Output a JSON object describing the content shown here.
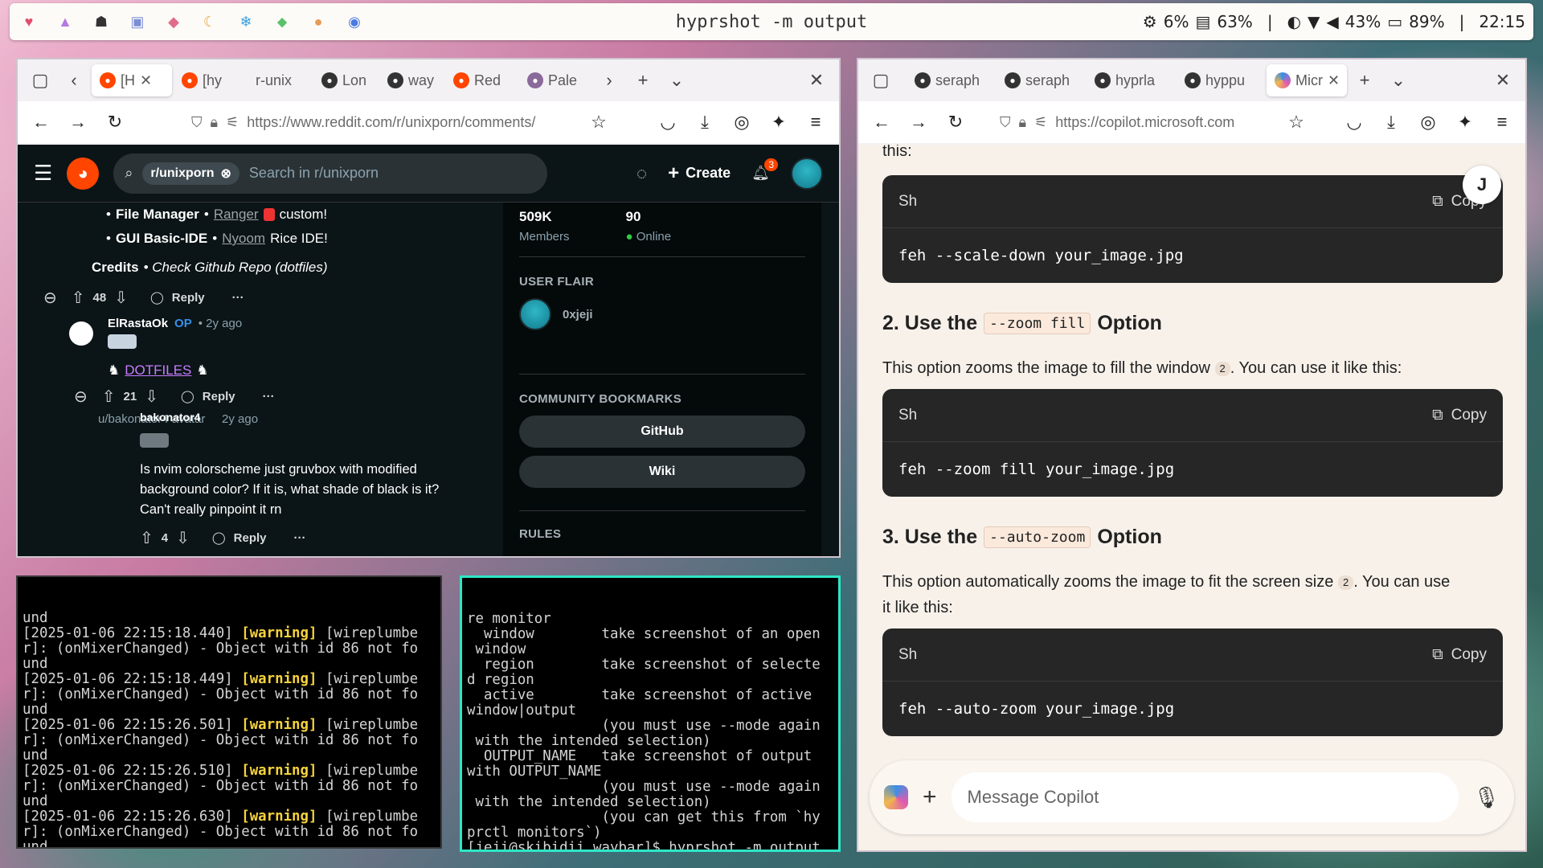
{
  "topbar": {
    "title": "hyprshot -m output",
    "cpu": "6%",
    "mem": "63%",
    "volume": "43%",
    "battery": "89%",
    "time": "22:15",
    "sep": "|"
  },
  "left_browser": {
    "tabs": [
      "[H",
      "[hy",
      "r-unix",
      "Lon",
      "way",
      "Red",
      "Pale"
    ],
    "url": "https://www.reddit.com/r/unixporn/comments/",
    "reddit": {
      "chip": "r/unixporn",
      "search_placeholder": "Search in r/unixporn",
      "create": "Create",
      "notif_count": "3",
      "post": {
        "fm_label": "File Manager",
        "fm_dot": "•",
        "fm_link": "Ranger",
        "fm_rest": "custom!",
        "ide_label": "GUI Basic-IDE",
        "ide_dot": "•",
        "ide_link": "Nyoom",
        "ide_rest": "Rice IDE!",
        "credits_label": "Credits",
        "credits_rest": "• Check Github Repo (dotfiles)",
        "votes": "48",
        "reply": "Reply",
        "more": "···"
      },
      "c1": {
        "user": "ElRastaOk",
        "op": "OP",
        "time": "• 2y ago",
        "link": "DOTFILES",
        "votes": "21",
        "reply": "Reply",
        "more": "···"
      },
      "c2": {
        "user": "bakonator4",
        "ghost": "u/bakonator4 avatar",
        "time": "2y ago",
        "text1": "Is nvim colorscheme just gruvbox with modified",
        "text2": "background color? If it is, what shade of black is it?",
        "text3": "Can't really pinpoint it rn",
        "votes": "4",
        "reply": "Reply",
        "more": "···"
      },
      "side": {
        "members_val": "509K",
        "members_lbl": "Members",
        "online_val": "90",
        "online_lbl": "Online",
        "flair_h": "USER FLAIR",
        "flair_user": "0xjeji",
        "bm_h": "COMMUNITY BOOKMARKS",
        "bm1": "GitHub",
        "bm2": "Wiki",
        "rules_h": "RULES"
      }
    }
  },
  "term1": {
    "lines": [
      {
        "t": "und"
      },
      {
        "a": "[2025-01-06 22:15:18.440] ",
        "w": "[warning]",
        "b": " [wireplumbe"
      },
      {
        "t": "r]: (onMixerChanged) - Object with id 86 not fo"
      },
      {
        "t": "und"
      },
      {
        "a": "[2025-01-06 22:15:18.449] ",
        "w": "[warning]",
        "b": " [wireplumbe"
      },
      {
        "t": "r]: (onMixerChanged) - Object with id 86 not fo"
      },
      {
        "t": "und"
      },
      {
        "a": "[2025-01-06 22:15:26.501] ",
        "w": "[warning]",
        "b": " [wireplumbe"
      },
      {
        "t": "r]: (onMixerChanged) - Object with id 86 not fo"
      },
      {
        "t": "und"
      },
      {
        "a": "[2025-01-06 22:15:26.510] ",
        "w": "[warning]",
        "b": " [wireplumbe"
      },
      {
        "t": "r]: (onMixerChanged) - Object with id 86 not fo"
      },
      {
        "t": "und"
      },
      {
        "a": "[2025-01-06 22:15:26.630] ",
        "w": "[warning]",
        "b": " [wireplumbe"
      },
      {
        "t": "r]: (onMixerChanged) - Object with id 86 not fo"
      },
      {
        "t": "und"
      }
    ]
  },
  "term2": {
    "lines": [
      "re monitor",
      "  window        take screenshot of an open",
      " window",
      "  region        take screenshot of selecte",
      "d region",
      "  active        take screenshot of active",
      "window|output",
      "                (you must use --mode again",
      " with the intended selection)",
      "  OUTPUT_NAME   take screenshot of output",
      "with OUTPUT_NAME",
      "                (you must use --mode again",
      " with the intended selection)",
      "                (you can get this from `hy",
      "prctl monitors`)",
      "[jeji@skibidii waybar]$ hyprshot -m output"
    ]
  },
  "right_browser": {
    "tabs": [
      "seraph",
      "seraph",
      "hyprla",
      "hyppu",
      "Micr"
    ],
    "url": "https://copilot.microsoft.com",
    "copilot": {
      "top_text": "this:",
      "avatar": "J",
      "b1_lang": "Sh",
      "b1_copy": "Copy",
      "b1_code": "feh --scale-down your_image.jpg",
      "h2_pre": "2. Use the",
      "h2_code": "--zoom fill",
      "h2_post": "Option",
      "p2": "This option zooms the image to fill the window",
      "p2_cite": "2",
      "p2_post": ". You can use it like this:",
      "b2_lang": "Sh",
      "b2_copy": "Copy",
      "b2_code": "feh --zoom fill your_image.jpg",
      "h3_pre": "3. Use the",
      "h3_code": "--auto-zoom",
      "h3_post": "Option",
      "p3a": "This option automatically zooms the image to fit the screen size",
      "p3_cite": "2",
      "p3b": ". You can use",
      "p3c": "it like this:",
      "b3_lang": "Sh",
      "b3_copy": "Copy",
      "b3_code": "feh --auto-zoom your_image.jpg",
      "msg_placeholder": "Message Copilot"
    }
  },
  "colors": {
    "reddit": "#ff4500",
    "warning": "#f6d33c",
    "accent_border": "#2ee6c6"
  }
}
